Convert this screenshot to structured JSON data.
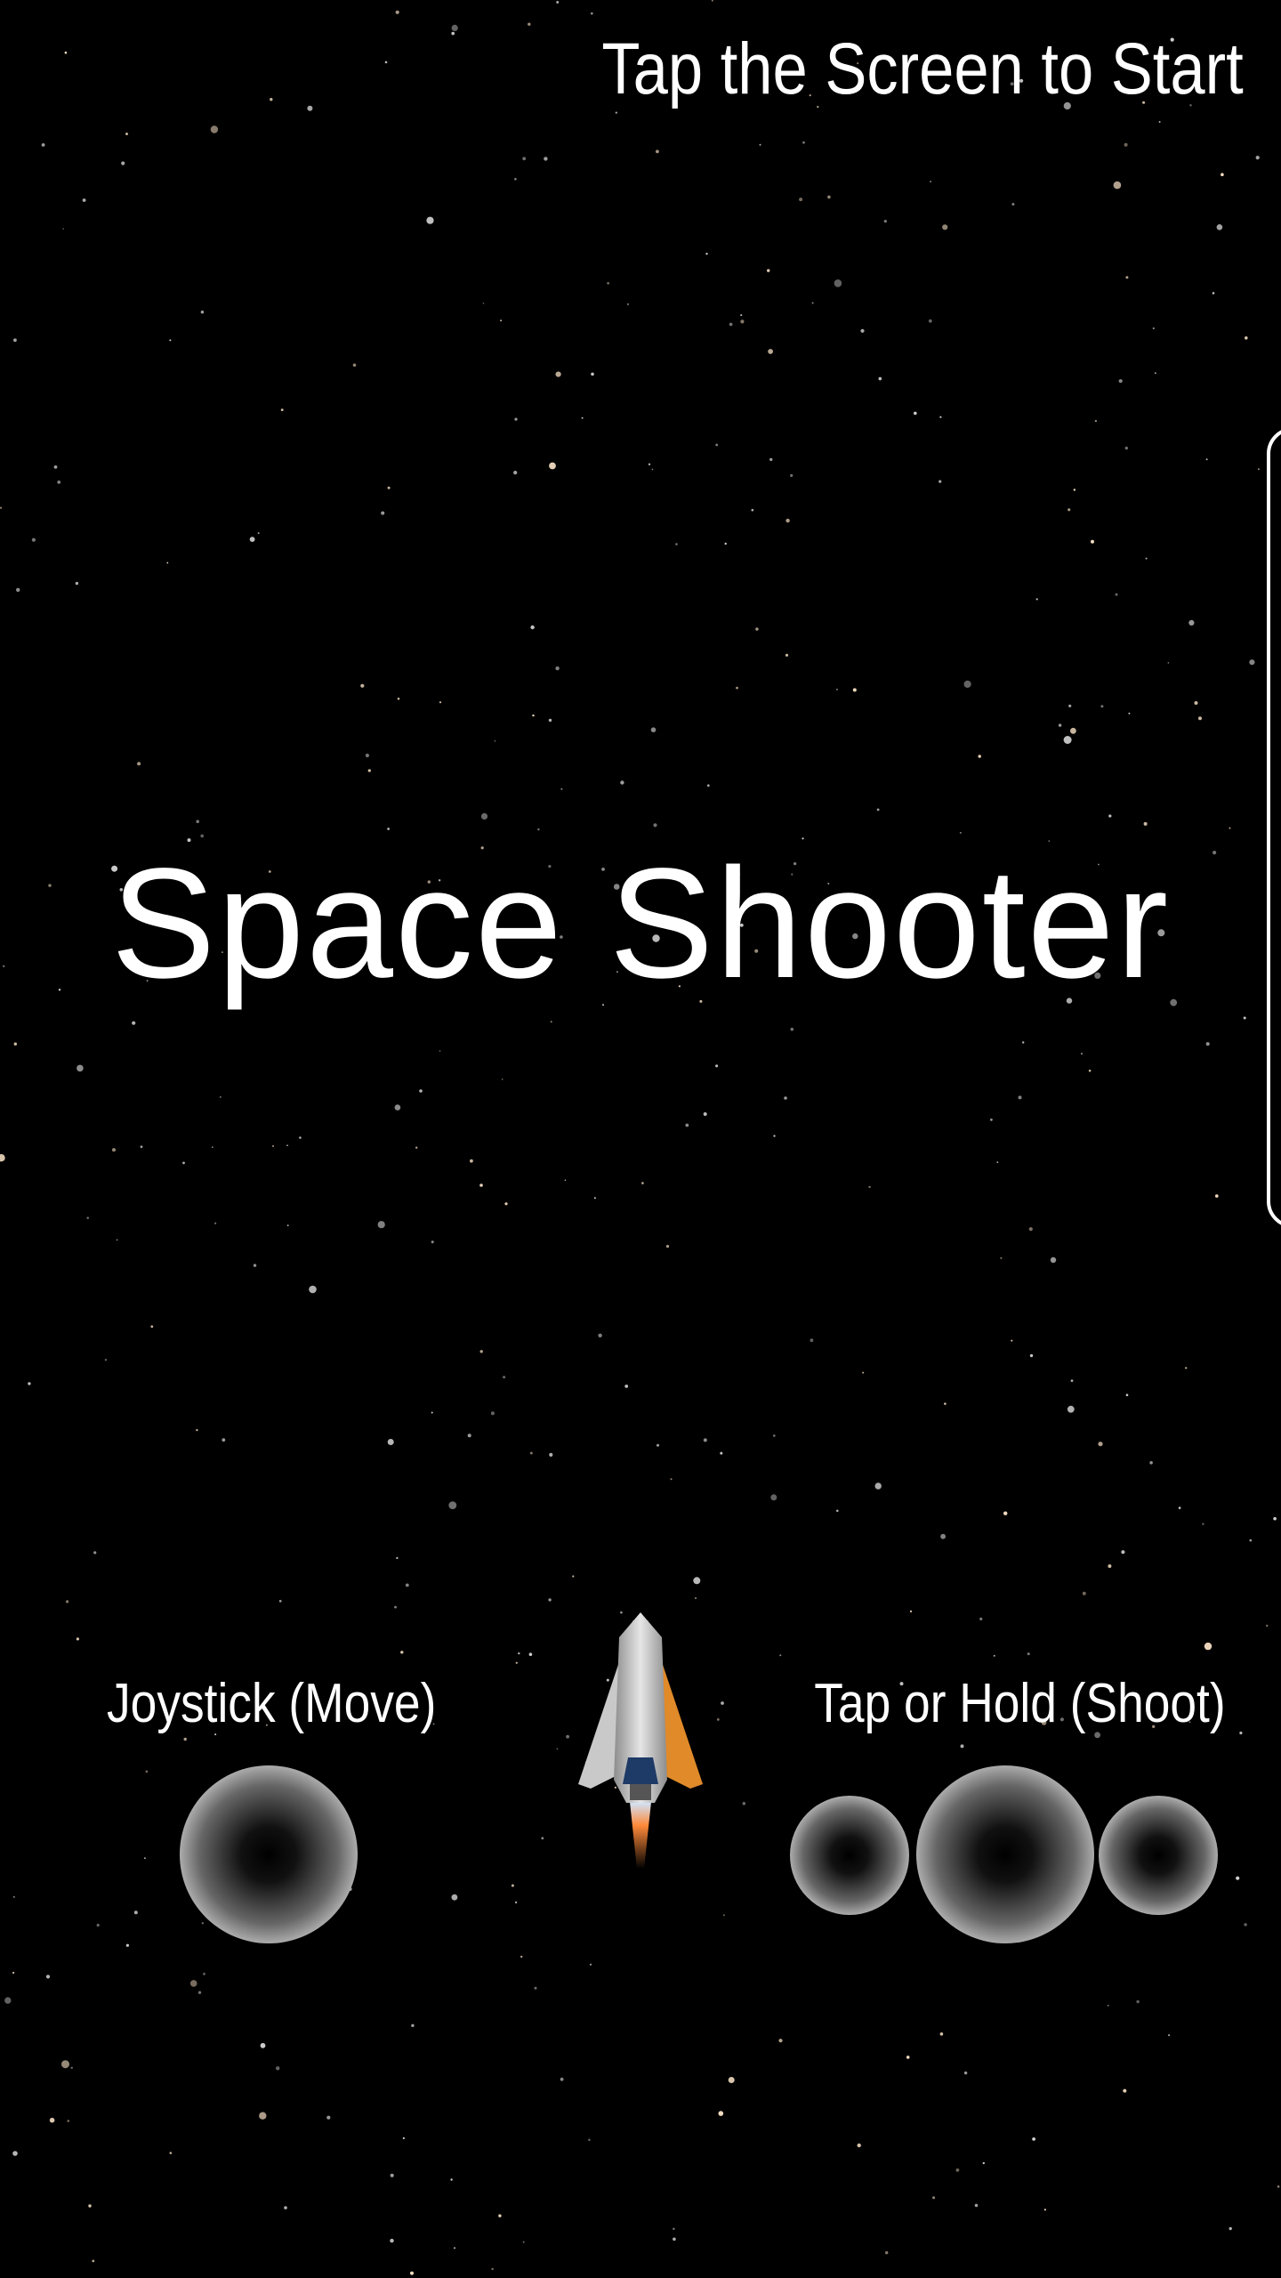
{
  "game": {
    "title": "Space Shooter",
    "start_prompt": "Tap the Screen to Start"
  },
  "controls": {
    "joystick_label": "Joystick (Move)",
    "shoot_label": "Tap or Hold (Shoot)"
  },
  "colors": {
    "background": "#000000",
    "text": "#ffffff",
    "ship_hull": "#c8c8c8",
    "ship_accent": "#e08a2a",
    "ship_cockpit": "#1e3a66",
    "thruster": "#ff8a3a"
  },
  "icons": {
    "player_ship": "spaceship-icon"
  }
}
